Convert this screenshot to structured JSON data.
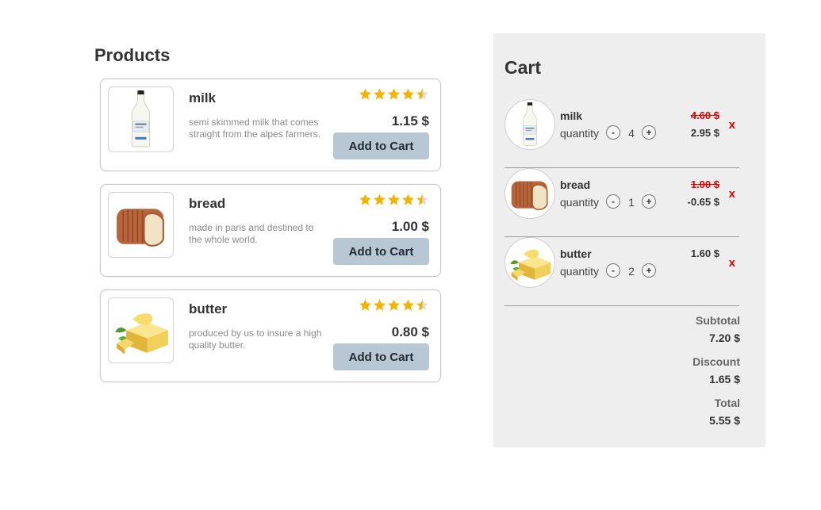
{
  "products_section": {
    "title": "Products",
    "items": [
      {
        "name": "milk",
        "description": "semi skimmed milk that comes straight from the alpes farmers.",
        "price": "1.15 $",
        "rating": 4.5,
        "button": "Add to Cart",
        "image_icon": "milk-bottle-icon"
      },
      {
        "name": "bread",
        "description": "made in paris and destined to the whole world.",
        "price": "1.00 $",
        "rating": 4.5,
        "button": "Add to Cart",
        "image_icon": "bread-loaf-icon"
      },
      {
        "name": "butter",
        "description": "produced by us to insure a high quality butter.",
        "price": "0.80 $",
        "rating": 4.5,
        "button": "Add to Cart",
        "image_icon": "butter-block-icon"
      }
    ]
  },
  "cart": {
    "title": "Cart",
    "quantity_label": "quantity",
    "minus": "-",
    "plus": "+",
    "remove": "x",
    "items": [
      {
        "name": "milk",
        "quantity": "4",
        "old_price": "4.60 $",
        "new_price": "2.95 $"
      },
      {
        "name": "bread",
        "quantity": "1",
        "old_price": "1.00 $",
        "new_price": "-0.65 $"
      },
      {
        "name": "butter",
        "quantity": "2",
        "price": "1.60 $"
      }
    ],
    "subtotal_label": "Subtotal",
    "subtotal_value": "7.20 $",
    "discount_label": "Discount",
    "discount_value": "1.65 $",
    "total_label": "Total",
    "total_value": "5.55 $"
  },
  "colors": {
    "star": "#f5b301",
    "button_bg": "#b8c7d4",
    "cart_bg": "#eeeeee",
    "strike_red": "#e00000"
  }
}
